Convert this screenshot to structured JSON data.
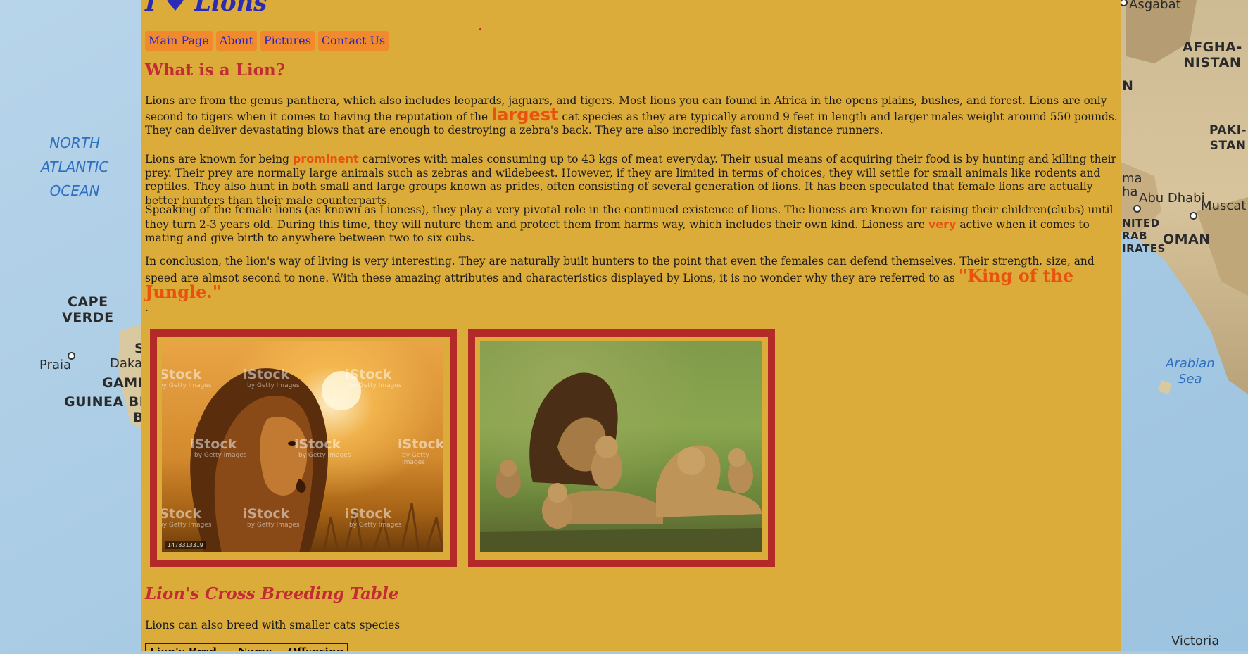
{
  "map": {
    "ocean_left": [
      "NORTH",
      "ATLANTIC",
      "OCEAN"
    ],
    "cape_verde": [
      "CAPE",
      "VERDE"
    ],
    "praia": "Praia",
    "dakar": "Dakar",
    "gambia": "GAMB",
    "guinea_bissau": "GUINEA BIS",
    "s_fragment": "S",
    "b_fragment": "B",
    "asgabat": "Asgabat",
    "afghanistan": [
      "AFGHA-",
      "NISTAN"
    ],
    "pakistan": [
      "PAKI-",
      "STAN"
    ],
    "n_fragment": "N",
    "ma_fragment": [
      "ma",
      "ha"
    ],
    "abu_dhabi": "Abu Dhabi",
    "muscat": "Muscat",
    "uae": [
      "NITED",
      "RAB",
      "IRATES"
    ],
    "oman": "OMAN",
    "arabian_sea": [
      "Arabian",
      "Sea"
    ],
    "victoria": "Victoria"
  },
  "site": {
    "title": "I ♥ Lions"
  },
  "nav": [
    "Main Page",
    "About",
    "Pictures",
    "Contact Us"
  ],
  "section1": {
    "heading": "What is a Lion?",
    "p1": {
      "a": "Lions are from the genus panthera, which also includes leopards, jaguars, and tigers. Most lions you can found in Africa in the opens plains, bushes, and forest. Lions are only second to tigers when it comes to having the reputation of the ",
      "hl": "largest",
      "b": " cat species as they are typically around 9 feet in length and larger males weight around 550 pounds. They can deliver devastating blows that are enough to destroying a zebra's back. They are also incredibly fast short distance runners."
    },
    "p2": {
      "a": "Lions are known for being ",
      "hl": "prominent",
      "b": " carnivores with males consuming up to 43 kgs of meat everyday. Their usual means of acquiring their food is by hunting and killing their prey. Their prey are normally large animals such as zebras and wildebeest. However, if they are limited in terms of choices, they will settle for small animals like rodents and reptiles. They also hunt in both small and large groups known as prides, often consisting of several generation of lions. It has been speculated that female lions are actually better hunters than their male counterparts."
    },
    "p3": {
      "a": "Speaking of the female lions (as known as Lioness), they play a very pivotal role in the continued existence of lions. The lioness are known for raising their children(clubs) until they turn 2-3 years old. During this time, they will nuture them and protect them from harms way, which includes their own kind. Lioness are ",
      "hl": "very",
      "b": " active when it comes to mating and give birth to anywhere between two to six cubs."
    },
    "p4": {
      "a": "In conclusion, the lion's way of living is very interesting. They are naturally built hunters to the point that even the females can defend themselves. Their strength, size, and speed are almsot second to none. With these amazing attributes and characteristics displayed by Lions, it is no wonder why they are referred to as ",
      "hl": "\"King of the Jungle.\""
    },
    "dot": "."
  },
  "pictures": {
    "watermark": "iStock",
    "watermark_sub": "by Getty Images",
    "stock_id": "1478313319"
  },
  "section2": {
    "heading": "Lion's Cross Breeding Table",
    "intro": "Lions can also breed with smaller cats species",
    "table_headers": [
      "Lion's Bred",
      "Name",
      "Offspring"
    ]
  }
}
